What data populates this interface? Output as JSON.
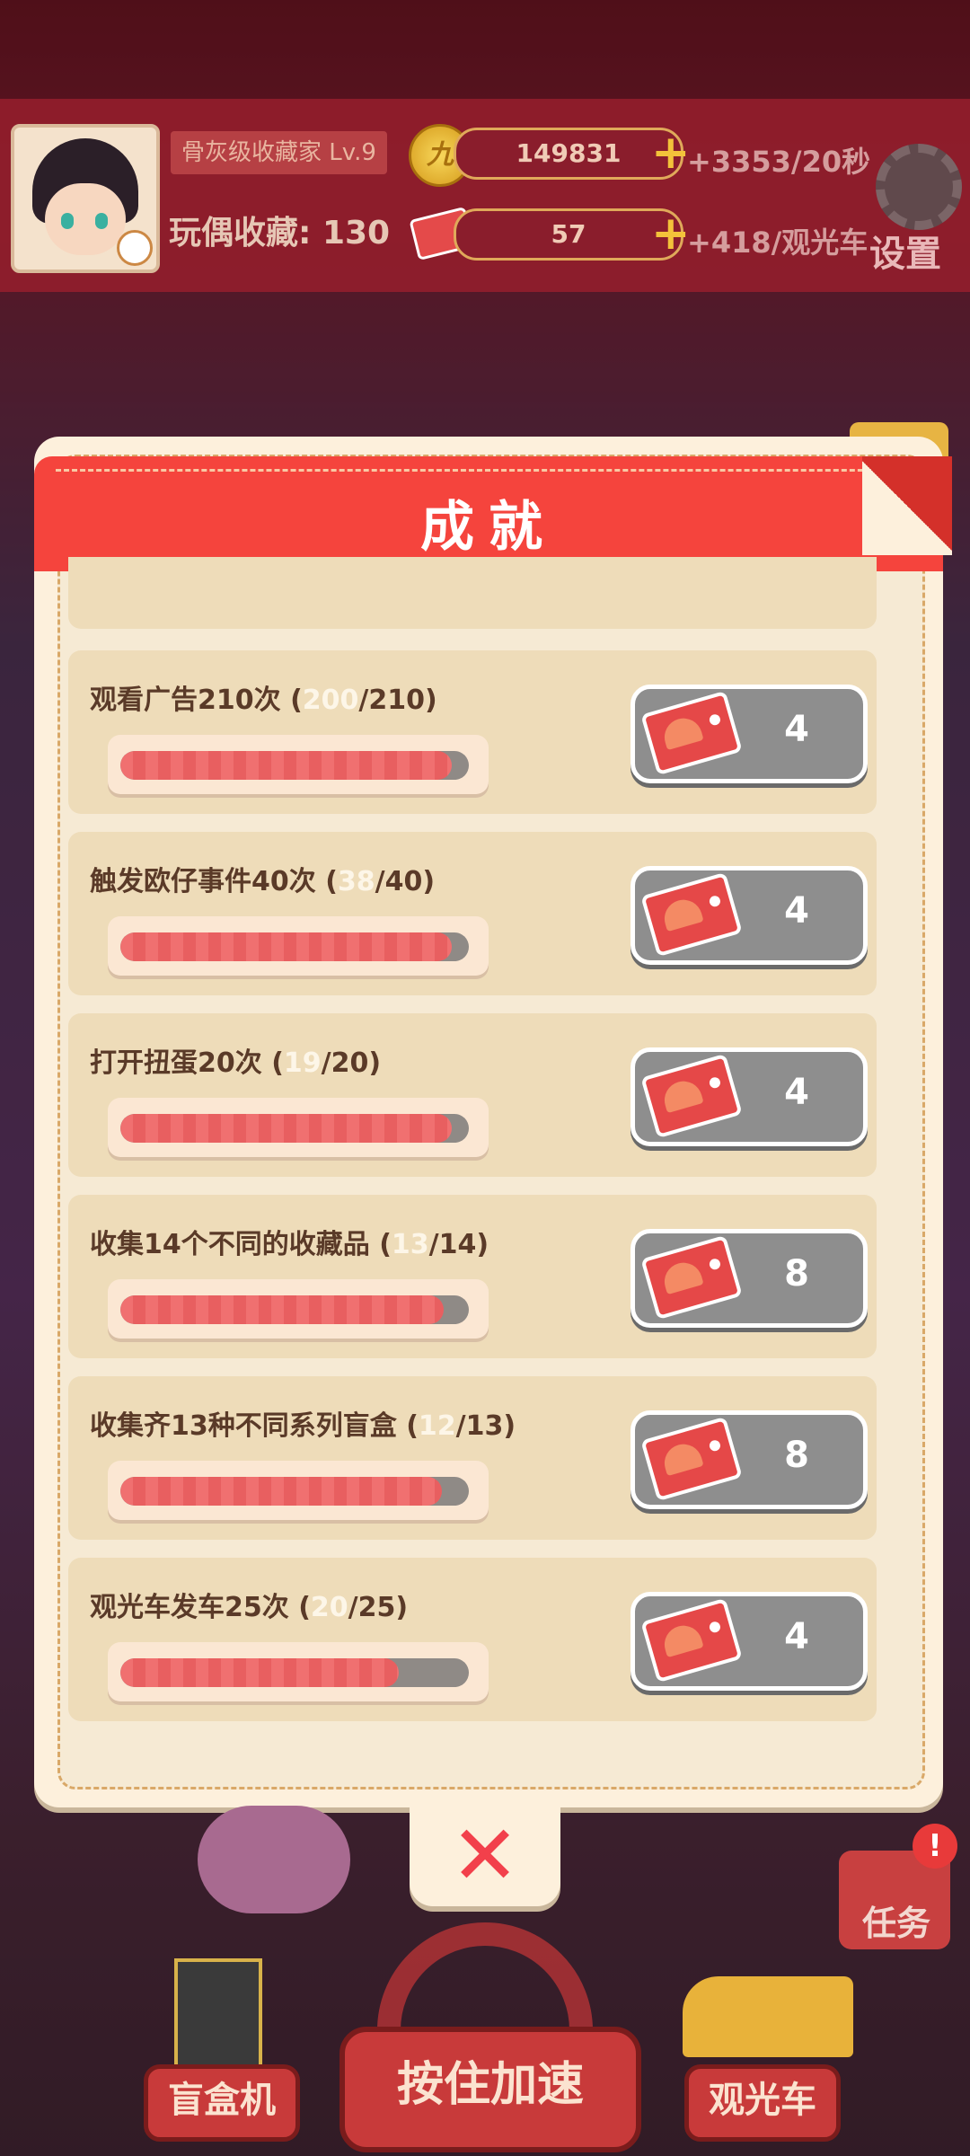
{
  "hud": {
    "title": "骨灰级收藏家 Lv.9",
    "collection_label": "玩偶收藏",
    "collection_count": "130",
    "coins": "149831",
    "coin_symbol": "九",
    "coin_rate": "+3353/20秒",
    "tickets": "57",
    "ticket_rate": "+418/观光车",
    "settings_label": "设置"
  },
  "modal": {
    "title": "成就",
    "close_glyph": "✕",
    "achievements": [
      {
        "name": "观看广告210次",
        "current": "200",
        "target": "210",
        "progress": 0.952,
        "reward": "4"
      },
      {
        "name": "触发欧仔事件40次",
        "current": "38",
        "target": "40",
        "progress": 0.95,
        "reward": "4"
      },
      {
        "name": "打开扭蛋20次",
        "current": "19",
        "target": "20",
        "progress": 0.95,
        "reward": "4"
      },
      {
        "name": "收集14个不同的收藏品",
        "current": "13",
        "target": "14",
        "progress": 0.929,
        "reward": "8"
      },
      {
        "name": "收集齐13种不同系列盲盒",
        "current": "12",
        "target": "13",
        "progress": 0.923,
        "reward": "8"
      },
      {
        "name": "观光车发车25次",
        "current": "20",
        "target": "25",
        "progress": 0.8,
        "reward": "4"
      }
    ]
  },
  "bottom": {
    "speed_label": "按住加速",
    "blindbox_label": "盲盒机",
    "sightseeing_label": "观光车",
    "task_label": "任务",
    "task_alert": "!"
  },
  "colors": {
    "ribbon": "#f5443d",
    "progress_fill": "#f07070",
    "reward_bg": "#8e8e8e",
    "close_x": "#f2404b"
  }
}
